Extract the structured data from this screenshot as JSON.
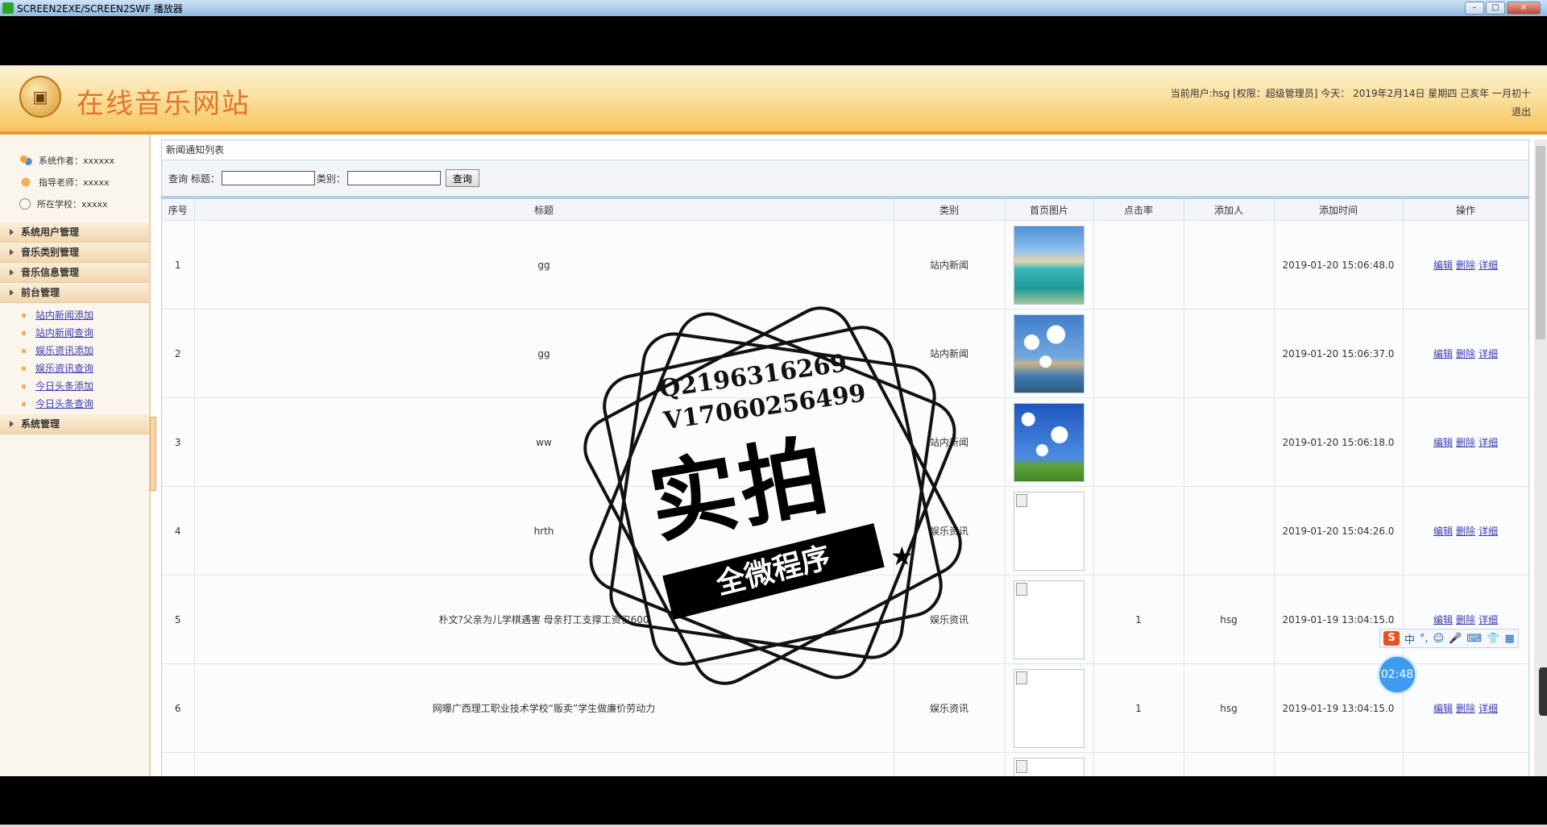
{
  "window": {
    "title": "SCREEN2EXE/SCREEN2SWF 播放器",
    "buttons": [
      "–",
      "□",
      "×"
    ]
  },
  "header": {
    "site_title": "在线音乐网站",
    "user_line": "当前用户:hsg [权限：超级管理员] 今天： 2019年2月14日 星期四 己亥年 一月初十",
    "logout_label": "退出"
  },
  "sidebar": {
    "info": [
      {
        "label": "系统作者：xxxxxx",
        "icon": "people-icon"
      },
      {
        "label": "指导老师：xxxxx",
        "icon": "teacher-icon"
      },
      {
        "label": "所在学校：xxxxx",
        "icon": "school-icon"
      }
    ],
    "menus": [
      {
        "label": "系统用户管理"
      },
      {
        "label": "音乐类别管理"
      },
      {
        "label": "音乐信息管理"
      },
      {
        "label": "前台管理",
        "items": [
          "站内新闻添加",
          "站内新闻查询",
          "娱乐资讯添加",
          "娱乐资讯查询",
          "今日头条添加",
          "今日头条查询"
        ]
      },
      {
        "label": "系统管理"
      }
    ]
  },
  "main": {
    "panel_title": "新闻通知列表",
    "search": {
      "prefix_label": "查询 标题：",
      "category_label": "类别：",
      "title_value": "",
      "category_value": "",
      "button_label": "查询"
    },
    "columns": [
      "序号",
      "标题",
      "类别",
      "首页图片",
      "点击率",
      "添加人",
      "添加时间",
      "操作"
    ],
    "actions": [
      "编辑",
      "删除",
      "详细"
    ],
    "rows": [
      {
        "no": "1",
        "title": "gg",
        "category": "站内新闻",
        "image": "beach",
        "clicks": "",
        "author": "",
        "time": "2019-01-20 15:06:48.0"
      },
      {
        "no": "2",
        "title": "gg",
        "category": "站内新闻",
        "image": "clouds",
        "clicks": "",
        "author": "",
        "time": "2019-01-20 15:06:37.0"
      },
      {
        "no": "3",
        "title": "ww",
        "category": "站内新闻",
        "image": "field",
        "clicks": "",
        "author": "",
        "time": "2019-01-20 15:06:18.0"
      },
      {
        "no": "4",
        "title": "hrth",
        "category": "娱乐资讯",
        "image": "broken",
        "clicks": "",
        "author": "",
        "time": "2019-01-20 15:04:26.0"
      },
      {
        "no": "5",
        "title": "朴文?父亲为儿学棋遇害 母亲打工支撑工资仅600",
        "category": "娱乐资讯",
        "image": "broken",
        "clicks": "1",
        "author": "hsg",
        "time": "2019-01-19 13:04:15.0"
      },
      {
        "no": "6",
        "title": "网曝广西理工职业技术学校“贩卖”学生做廉价劳动力",
        "category": "娱乐资讯",
        "image": "broken",
        "clicks": "1",
        "author": "hsg",
        "time": "2019-01-19 13:04:15.0"
      },
      {
        "no": "",
        "title": "",
        "category": "",
        "image": "broken",
        "clicks": "",
        "author": "",
        "time": ""
      }
    ]
  },
  "watermark": {
    "line1": "Q2196316269",
    "line2": "V17060256499",
    "big": "实拍",
    "ribbon": "全微程序"
  },
  "ime": {
    "items": [
      "中",
      "°,",
      "☺",
      "🎤",
      "⌨",
      "👕",
      "▦"
    ]
  },
  "timer": "02:48"
}
